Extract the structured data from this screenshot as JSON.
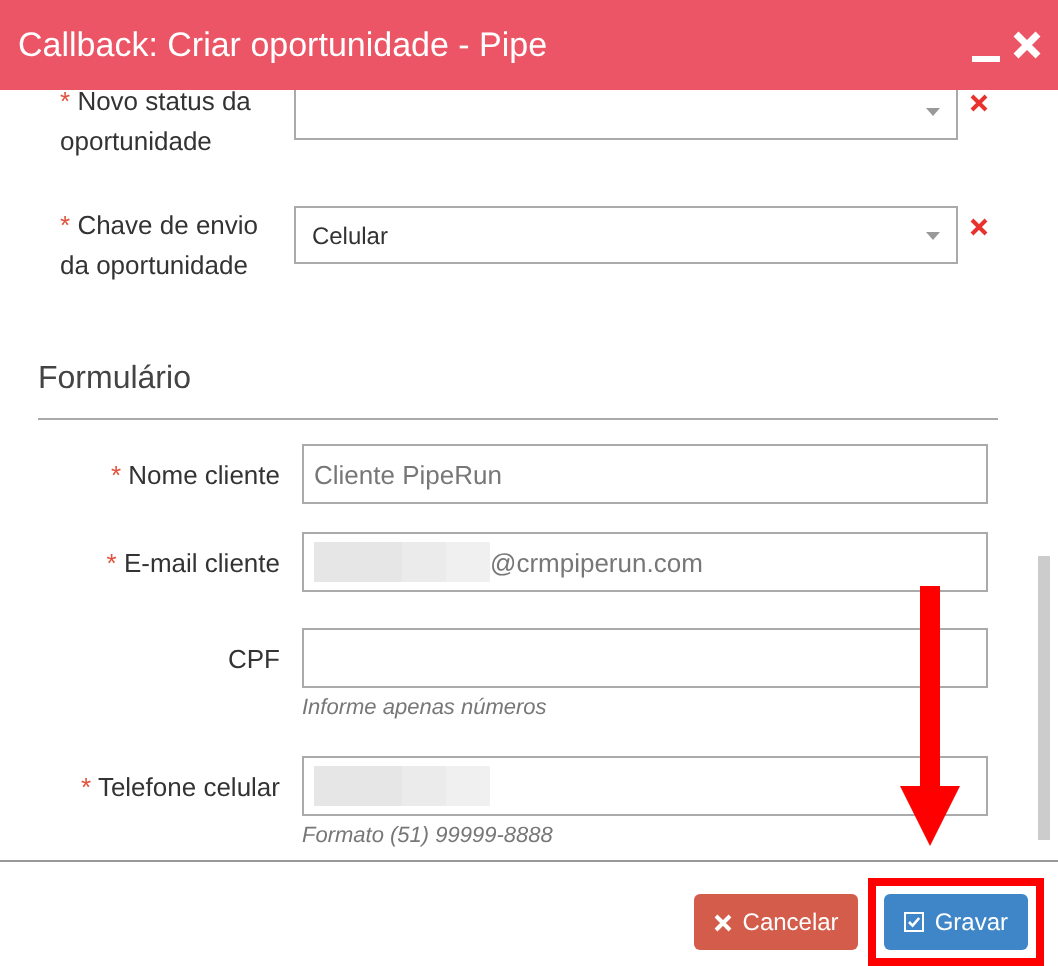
{
  "window": {
    "title": "Callback: Criar oportunidade - Pipe"
  },
  "top_fields": [
    {
      "required_mark": "*",
      "label": "Novo status da oportunidade"
    },
    {
      "required_mark": "*",
      "label": "Chave de envio da oportunidade",
      "value": "Celular"
    }
  ],
  "section": {
    "title": "Formulário"
  },
  "form_fields": [
    {
      "required_mark": "*",
      "label": "Nome cliente",
      "placeholder": "Cliente PipeRun",
      "redacted": false
    },
    {
      "required_mark": "*",
      "label": "E-mail cliente",
      "value": "@crmpiperun.com",
      "redacted": true
    },
    {
      "label": "CPF",
      "hint": "Informe apenas números",
      "redacted": false
    },
    {
      "required_mark": "*",
      "label": "Telefone celular",
      "hint": "Formato (51) 99999-8888",
      "redacted": true
    }
  ],
  "buttons": [
    {
      "label": "Cancelar",
      "kind": "cancel",
      "highlighted": false
    },
    {
      "label": "Gravar",
      "kind": "save",
      "highlighted": true
    }
  ]
}
